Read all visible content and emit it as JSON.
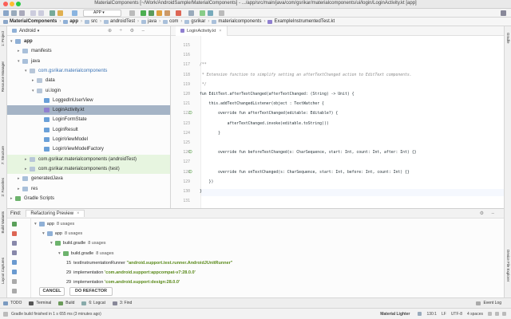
{
  "window": {
    "title": "MaterialComponents [~/Work/AndroidSample/MaterialComponents] - .../app/src/main/java/com/gsrikar/materialcomponents/ui/login/LoginActivity.kt [app]",
    "run_config": "APP"
  },
  "breadcrumbs": [
    "MaterialComponents",
    "app",
    "src",
    "androidTest",
    "java",
    "com",
    "gsrikar",
    "materialcomponents",
    "ExampleInstrumentedTest.kt"
  ],
  "left_tool_tabs": [
    "1: Project",
    "Resource Manager",
    "7: Structure",
    "2: Favorites",
    "Build Variants",
    "Layout Captures"
  ],
  "right_tool_tabs": [
    "Gradle",
    "Device File Explorer"
  ],
  "project": {
    "view_selector": "Android",
    "tree": [
      {
        "label": "app",
        "level": 0,
        "icon": "module-icon",
        "bold": true
      },
      {
        "label": "manifests",
        "level": 1,
        "icon": "folder-icon"
      },
      {
        "label": "java",
        "level": 1,
        "icon": "folder-icon"
      },
      {
        "label": "com.gsrikar.materialcomponents",
        "level": 2,
        "icon": "package-icon",
        "tone": "pkg"
      },
      {
        "label": "data",
        "level": 3,
        "icon": "package-icon"
      },
      {
        "label": "ui.login",
        "level": 3,
        "icon": "package-icon"
      },
      {
        "label": "LoggedInUserView",
        "level": 4,
        "icon": "kotlin-class-icon"
      },
      {
        "label": "LoginActivity.kt",
        "level": 4,
        "icon": "kotlin-file-icon",
        "selected": true
      },
      {
        "label": "LoginFormState",
        "level": 4,
        "icon": "kotlin-class-icon"
      },
      {
        "label": "LoginResult",
        "level": 4,
        "icon": "kotlin-class-icon"
      },
      {
        "label": "LoginViewModel",
        "level": 4,
        "icon": "kotlin-class-icon"
      },
      {
        "label": "LoginViewModelFactory",
        "level": 4,
        "icon": "kotlin-class-icon"
      },
      {
        "label": "com.gsrikar.materialcomponents (androidTest)",
        "level": 2,
        "icon": "package-icon",
        "highlight": true
      },
      {
        "label": "com.gsrikar.materialcomponents (test)",
        "level": 2,
        "icon": "package-icon",
        "highlight": true
      },
      {
        "label": "generatedJava",
        "level": 1,
        "icon": "folder-icon"
      },
      {
        "label": "res",
        "level": 1,
        "icon": "folder-icon"
      },
      {
        "label": "Gradle Scripts",
        "level": 0,
        "icon": "gradle-icon"
      }
    ]
  },
  "editor": {
    "tab": "LoginActivity.kt",
    "lines": [
      {
        "n": "115",
        "text": ""
      },
      {
        "n": "116",
        "text": ""
      },
      {
        "n": "117",
        "text": "/**",
        "cls": "cm"
      },
      {
        "n": "118",
        "text": " * Extension function to simplify setting an afterTextChanged action to EditText components.",
        "cls": "cm"
      },
      {
        "n": "119",
        "text": " */",
        "cls": "cm"
      },
      {
        "n": "120",
        "text": "fun EditText.afterTextChanged(afterTextChanged: (String) -> Unit) {"
      },
      {
        "n": "121",
        "text": "    this.addTextChangedListener(object : TextWatcher {"
      },
      {
        "n": "122",
        "text": "        override fun afterTextChanged(editable: Editable?) {",
        "gutter": "override"
      },
      {
        "n": "123",
        "text": "            afterTextChanged.invoke(editable.toString())"
      },
      {
        "n": "124",
        "text": "        }"
      },
      {
        "n": "125",
        "text": ""
      },
      {
        "n": "126",
        "text": "        override fun beforeTextChanged(s: CharSequence, start: Int, count: Int, after: Int) {}",
        "gutter": "override"
      },
      {
        "n": "127",
        "text": ""
      },
      {
        "n": "128",
        "text": "        override fun onTextChanged(s: CharSequence, start: Int, before: Int, count: Int) {}",
        "gutter": "override"
      },
      {
        "n": "129",
        "text": "    })"
      },
      {
        "n": "130",
        "text": "}"
      },
      {
        "n": "131",
        "text": ""
      }
    ],
    "current_line": "130"
  },
  "find": {
    "label": "Find:",
    "tab": "Refactoring Preview",
    "rows": [
      {
        "level": 0,
        "icon": "module-icon",
        "text": "app",
        "suffix": "8 usages"
      },
      {
        "level": 1,
        "icon": "module-icon",
        "text": "app",
        "suffix": "8 usages"
      },
      {
        "level": 2,
        "icon": "gradle-icon",
        "text": "build.gradle",
        "suffix": "8 usages"
      },
      {
        "level": 3,
        "icon": "gradle-icon",
        "text": "build.gradle",
        "suffix": "8 usages"
      },
      {
        "level": 4,
        "num": "15",
        "prefix": "testInstrumentationRunner ",
        "value": "\"android.support.test.runner.AndroidJUnitRunner\""
      },
      {
        "level": 4,
        "num": "29",
        "prefix": "implementation ",
        "value": "'com.android.support:appcompat-v7:28.0.0'"
      },
      {
        "level": 4,
        "num": "29",
        "prefix": "implementation ",
        "value": "'com.android.support:design:28.0.0'"
      }
    ],
    "cancel": "CANCEL",
    "do_refactor": "DO REFACTOR"
  },
  "bottom_tabs": [
    "TODO",
    "Terminal",
    "Build",
    "6: Logcat",
    "3: Find"
  ],
  "event_log": "Event Log",
  "status": {
    "message": "Gradle build finished in 1 s 655 ms (3 minutes ago)",
    "theme": "Material Lighter",
    "position": "130:1",
    "line_sep": "LF",
    "encoding": "UTF-8",
    "indent": "4 spaces"
  },
  "colors": {
    "accent": "#5e8fcc",
    "selection": "#a5b4c6",
    "green": "#4b9b3a"
  }
}
